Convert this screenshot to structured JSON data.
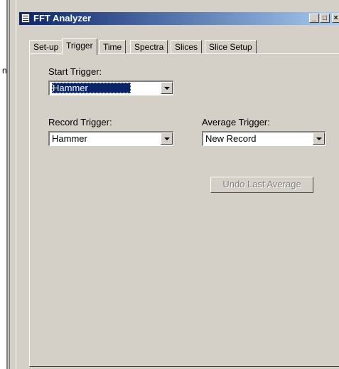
{
  "window": {
    "title": "FFT Analyzer"
  },
  "left_partial_text": "n",
  "tabs": [
    {
      "label": "Set-up"
    },
    {
      "label": "Trigger",
      "active": true
    },
    {
      "label": "Time"
    },
    {
      "label": "Spectra"
    },
    {
      "label": "Slices"
    },
    {
      "label": "Slice Setup"
    }
  ],
  "form": {
    "start_trigger": {
      "label": "Start Trigger:",
      "value": "Hammer"
    },
    "record_trigger": {
      "label": "Record Trigger:",
      "value": "Hammer"
    },
    "average_trigger": {
      "label": "Average Trigger:",
      "value": "New Record"
    },
    "undo_button": "Undo Last Average"
  }
}
